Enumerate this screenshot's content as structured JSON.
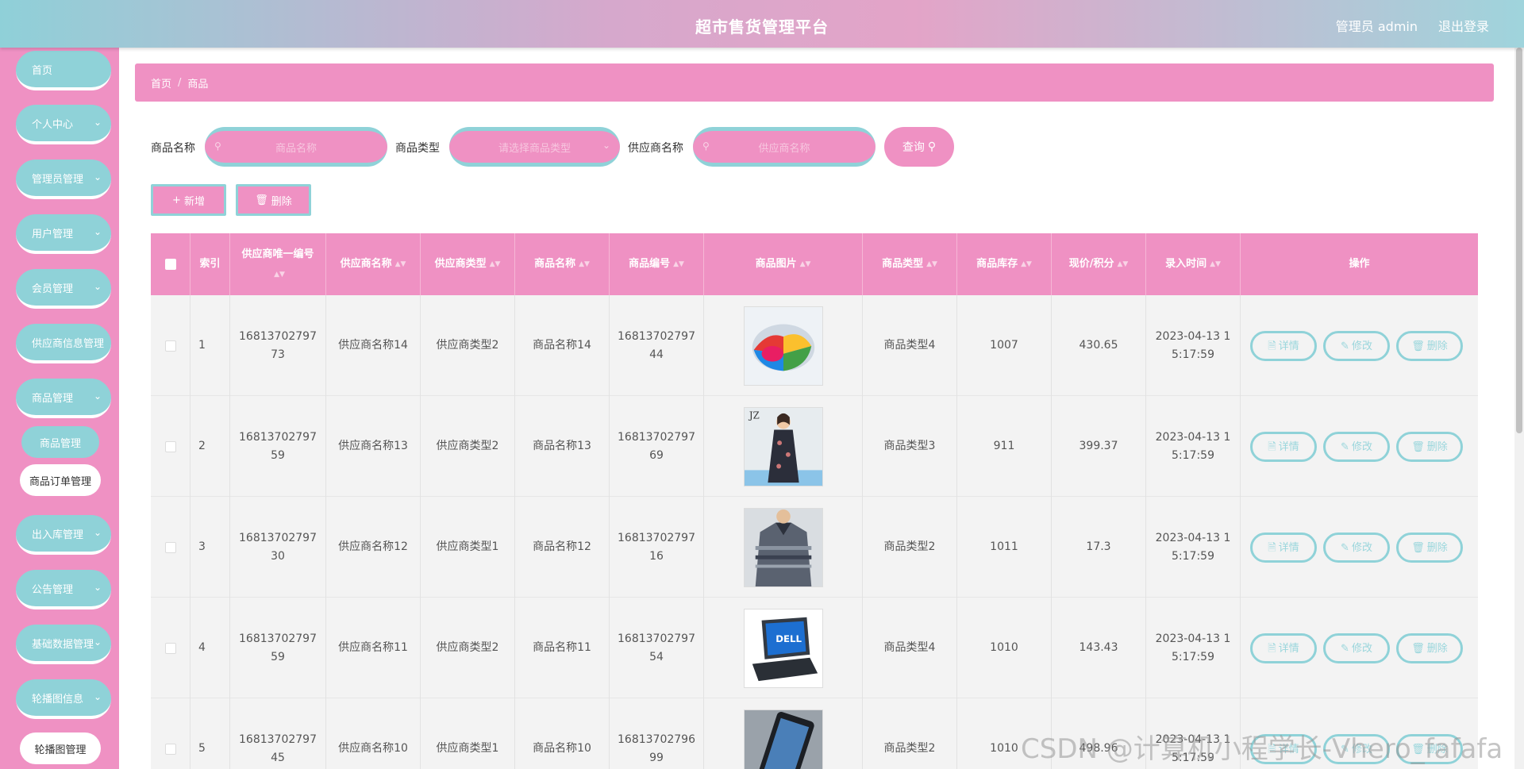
{
  "header": {
    "title": "超市售货管理平台",
    "user": "管理员 admin",
    "logout": "退出登录"
  },
  "sidebar": {
    "items": [
      {
        "label": "首页",
        "has_chevron": false
      },
      {
        "label": "个人中心",
        "has_chevron": true
      },
      {
        "label": "管理员管理",
        "has_chevron": true
      },
      {
        "label": "用户管理",
        "has_chevron": true
      },
      {
        "label": "会员管理",
        "has_chevron": true
      },
      {
        "label": "供应商信息管理",
        "has_chevron": false
      },
      {
        "label": "商品管理",
        "has_chevron": true
      }
    ],
    "sub_items": [
      "商品管理",
      "商品订单管理"
    ],
    "items_after": [
      {
        "label": "出入库管理",
        "has_chevron": true
      },
      {
        "label": "公告管理",
        "has_chevron": true
      },
      {
        "label": "基础数据管理",
        "has_chevron": true
      },
      {
        "label": "轮播图信息",
        "has_chevron": true
      }
    ],
    "last_sub": "轮播图管理"
  },
  "breadcrumb": {
    "home": "首页",
    "separator": "/",
    "current": "商品"
  },
  "search": {
    "name_label": "商品名称",
    "name_placeholder": "商品名称",
    "type_label": "商品类型",
    "type_placeholder": "请选择商品类型",
    "supplier_label": "供应商名称",
    "supplier_placeholder": "供应商名称",
    "query_button": "查询"
  },
  "actions": {
    "add": "新增",
    "delete": "删除"
  },
  "table": {
    "headers": {
      "index": "索引",
      "supplier_id": "供应商唯一编号",
      "supplier_name": "供应商名称",
      "supplier_type": "供应商类型",
      "product_name": "商品名称",
      "product_code": "商品编号",
      "product_image": "商品图片",
      "product_type": "商品类型",
      "stock": "商品库存",
      "price": "现价/积分",
      "created": "录入时间",
      "ops": "操作"
    },
    "op_labels": {
      "detail": "详情",
      "edit": "修改",
      "delete": "删除"
    },
    "rows": [
      {
        "index": "1",
        "supplier_id": "1681370279773",
        "supplier_name": "供应商名称14",
        "supplier_type": "供应商类型2",
        "product_name": "商品名称14",
        "product_code": "1681370279744",
        "image": "storage-box",
        "product_type": "商品类型4",
        "stock": "1007",
        "price": "430.65",
        "created": "2023-04-13 15:17:59"
      },
      {
        "index": "2",
        "supplier_id": "1681370279759",
        "supplier_name": "供应商名称13",
        "supplier_type": "供应商类型2",
        "product_name": "商品名称13",
        "product_code": "1681370279769",
        "image": "dress",
        "product_type": "商品类型3",
        "stock": "911",
        "price": "399.37",
        "created": "2023-04-13 15:17:59"
      },
      {
        "index": "3",
        "supplier_id": "1681370279730",
        "supplier_name": "供应商名称12",
        "supplier_type": "供应商类型1",
        "product_name": "商品名称12",
        "product_code": "1681370279716",
        "image": "polo-shirt",
        "product_type": "商品类型2",
        "stock": "1011",
        "price": "17.3",
        "created": "2023-04-13 15:17:59"
      },
      {
        "index": "4",
        "supplier_id": "1681370279759",
        "supplier_name": "供应商名称11",
        "supplier_type": "供应商类型2",
        "product_name": "商品名称11",
        "product_code": "1681370279754",
        "image": "laptop",
        "product_type": "商品类型4",
        "stock": "1010",
        "price": "143.43",
        "created": "2023-04-13 15:17:59"
      },
      {
        "index": "5",
        "supplier_id": "1681370279745",
        "supplier_name": "供应商名称10",
        "supplier_type": "供应商类型1",
        "product_name": "商品名称10",
        "product_code": "1681370279699",
        "image": "phone",
        "product_type": "商品类型2",
        "stock": "1010",
        "price": "498.96",
        "created": "2023-04-13 15:17:59"
      }
    ]
  },
  "watermark": "CSDN @计算机小程学长-Vhero_fafafa",
  "colors": {
    "pink": "#ef91c3",
    "teal": "#8fd2d8"
  }
}
